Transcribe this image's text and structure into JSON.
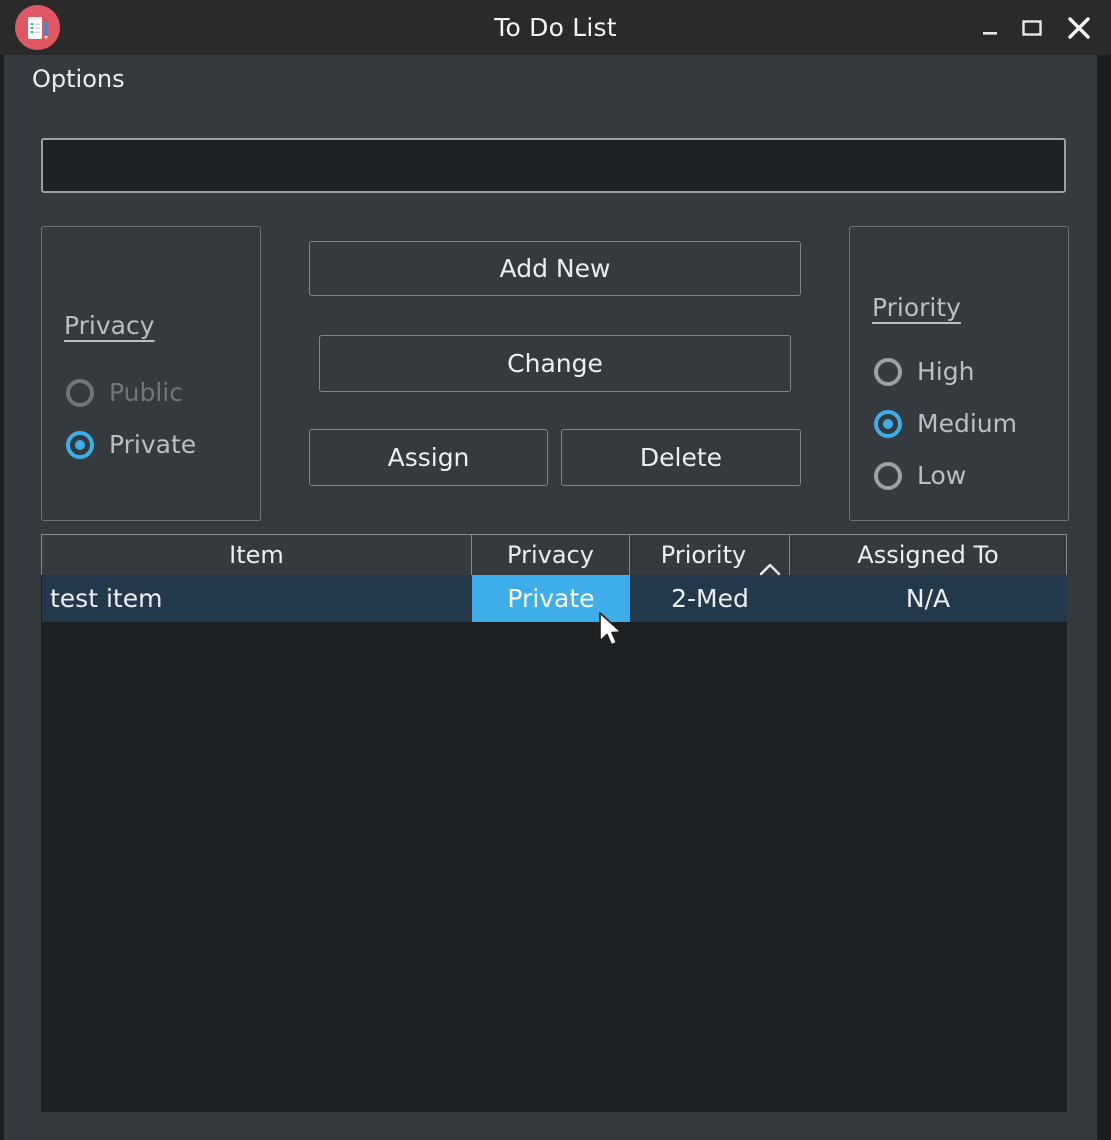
{
  "window": {
    "title": "To Do List",
    "icon": "todo-list-notepad-pencil-icon",
    "controls": {
      "minimize": "minimize-icon",
      "maximize": "maximize-icon",
      "close": "close-icon"
    }
  },
  "menubar": {
    "items": [
      {
        "label": "Options"
      }
    ]
  },
  "input": {
    "value": "",
    "placeholder": ""
  },
  "privacy_group": {
    "title": "Privacy",
    "options": [
      {
        "label": "Public",
        "selected": false,
        "disabled": true
      },
      {
        "label": "Private",
        "selected": true,
        "disabled": false
      }
    ]
  },
  "priority_group": {
    "title": "Priority",
    "options": [
      {
        "label": "High",
        "selected": false,
        "disabled": false
      },
      {
        "label": "Medium",
        "selected": true,
        "disabled": false
      },
      {
        "label": "Low",
        "selected": false,
        "disabled": false
      }
    ]
  },
  "actions": {
    "add_new": "Add New",
    "change": "Change",
    "assign": "Assign",
    "delete": "Delete"
  },
  "table": {
    "columns": [
      {
        "label": "Item",
        "sort": "none"
      },
      {
        "label": "Privacy",
        "sort": "none"
      },
      {
        "label": "Priority",
        "sort": "ascending",
        "sort_icon": "chevron-up-icon"
      },
      {
        "label": "Assigned To",
        "sort": "none"
      }
    ],
    "rows": [
      {
        "item": "test item",
        "privacy": "Private",
        "priority": "2-Med",
        "assigned_to": "N/A",
        "selected": true,
        "focused_cell": "privacy"
      }
    ]
  },
  "colors": {
    "titlebar_bg": "#2a2a2a",
    "window_bg": "#343a3e",
    "field_bg": "#1d2225",
    "accent": "#3daee9",
    "row_selected_bg": "#23384a",
    "text": "#eceff1",
    "text_muted": "#b9bfc4",
    "text_disabled": "#6f767b",
    "border": "#7d848a",
    "icon_circle": "#e05663"
  }
}
